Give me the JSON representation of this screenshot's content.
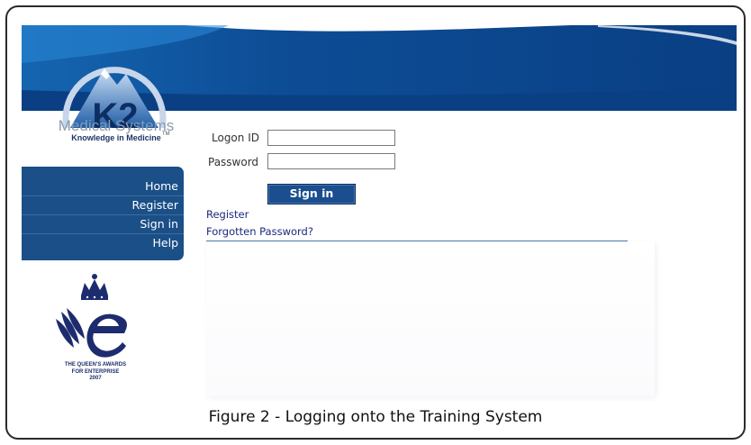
{
  "header": {
    "logo_monogram": "K2",
    "logo_tm": "TM",
    "brand_name": "Medical Systems",
    "tagline": "Knowledge in Medicine"
  },
  "nav": {
    "items": [
      {
        "label": "Home"
      },
      {
        "label": "Register"
      },
      {
        "label": "Sign in"
      },
      {
        "label": "Help"
      }
    ]
  },
  "form": {
    "logon_label": "Logon ID",
    "logon_value": "",
    "password_label": "Password",
    "password_value": "",
    "signin_label": "Sign in"
  },
  "links": {
    "register": "Register",
    "forgotten_password": "Forgotten Password?"
  },
  "award": {
    "line1": "THE QUEEN'S AWARDS",
    "line2": "FOR ENTERPRISE",
    "line3": "2007"
  },
  "caption": "Figure 2 - Logging onto the Training System",
  "colors": {
    "header_blue": "#0e4a8f",
    "nav_blue": "#1a4f87",
    "link_blue": "#1b2a7d",
    "frame": "#2a2a2a"
  }
}
